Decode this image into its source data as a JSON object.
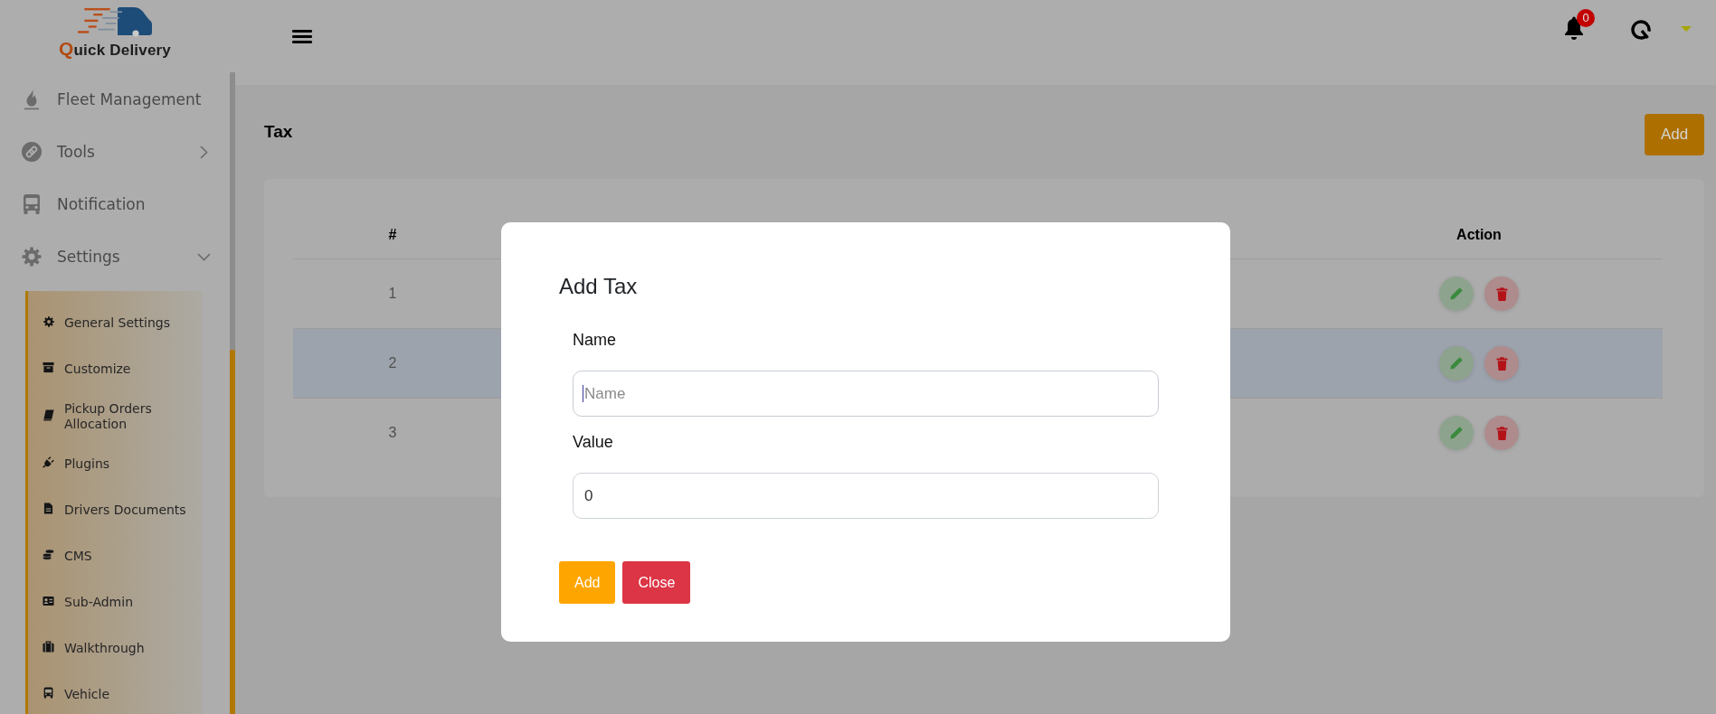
{
  "sidebar": {
    "logo": {
      "text": "Quick Delivery"
    },
    "items": [
      {
        "label": "Fleet Management",
        "kind": "link"
      },
      {
        "label": "Tools",
        "kind": "menu",
        "expanded": false
      },
      {
        "label": "Notification",
        "kind": "link"
      },
      {
        "label": "Settings",
        "kind": "menu",
        "expanded": true,
        "children": [
          {
            "label": "General Settings"
          },
          {
            "label": "Customize"
          },
          {
            "label": "Pickup Orders Allocation"
          },
          {
            "label": "Plugins"
          },
          {
            "label": "Drivers Documents"
          },
          {
            "label": "CMS"
          },
          {
            "label": "Sub-Admin"
          },
          {
            "label": "Walkthrough"
          },
          {
            "label": "Vehicle"
          }
        ]
      }
    ]
  },
  "top_bar": {
    "notifications": {
      "count": "0"
    }
  },
  "page": {
    "title": "Tax",
    "add_button": "Add"
  },
  "table": {
    "columns": [
      "#",
      "Action"
    ],
    "rows": [
      {
        "number": "1",
        "selected": false
      },
      {
        "number": "2",
        "selected": true
      },
      {
        "number": "3",
        "selected": false
      }
    ]
  },
  "modal": {
    "title": "Add Tax",
    "fields": [
      {
        "label": "Name",
        "placeholder": "Name",
        "focused": true
      },
      {
        "label": "Value",
        "value": "0",
        "focused": false
      }
    ],
    "buttons": [
      {
        "label": "Add",
        "kind": "primary"
      },
      {
        "label": "Close",
        "kind": "danger"
      }
    ]
  }
}
